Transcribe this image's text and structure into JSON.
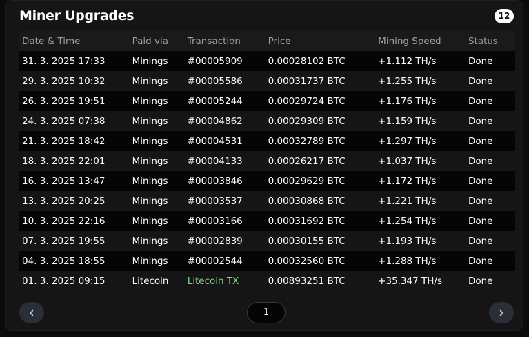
{
  "header": {
    "title": "Miner Upgrades",
    "count": "12"
  },
  "table": {
    "columns": [
      "Date & Time",
      "Paid via",
      "Transaction",
      "Price",
      "Mining Speed",
      "Status"
    ],
    "rows": [
      {
        "date": "31. 3. 2025 17:33",
        "paid": "Minings",
        "tx": "#00005909",
        "price": "0.00028102 BTC",
        "speed": "+1.112 TH/s",
        "status": "Done"
      },
      {
        "date": "29. 3. 2025 10:32",
        "paid": "Minings",
        "tx": "#00005586",
        "price": "0.00031737 BTC",
        "speed": "+1.255 TH/s",
        "status": "Done"
      },
      {
        "date": "26. 3. 2025 19:51",
        "paid": "Minings",
        "tx": "#00005244",
        "price": "0.00029724 BTC",
        "speed": "+1.176 TH/s",
        "status": "Done"
      },
      {
        "date": "24. 3. 2025 07:38",
        "paid": "Minings",
        "tx": "#00004862",
        "price": "0.00029309 BTC",
        "speed": "+1.159 TH/s",
        "status": "Done"
      },
      {
        "date": "21. 3. 2025 18:42",
        "paid": "Minings",
        "tx": "#00004531",
        "price": "0.00032789 BTC",
        "speed": "+1.297 TH/s",
        "status": "Done"
      },
      {
        "date": "18. 3. 2025 22:01",
        "paid": "Minings",
        "tx": "#00004133",
        "price": "0.00026217 BTC",
        "speed": "+1.037 TH/s",
        "status": "Done"
      },
      {
        "date": "16. 3. 2025 13:47",
        "paid": "Minings",
        "tx": "#00003846",
        "price": "0.00029629 BTC",
        "speed": "+1.172 TH/s",
        "status": "Done"
      },
      {
        "date": "13. 3. 2025 20:25",
        "paid": "Minings",
        "tx": "#00003537",
        "price": "0.00030868 BTC",
        "speed": "+1.221 TH/s",
        "status": "Done"
      },
      {
        "date": "10. 3. 2025 22:16",
        "paid": "Minings",
        "tx": "#00003166",
        "price": "0.00031692 BTC",
        "speed": "+1.254 TH/s",
        "status": "Done"
      },
      {
        "date": "07. 3. 2025 19:55",
        "paid": "Minings",
        "tx": "#00002839",
        "price": "0.00030155 BTC",
        "speed": "+1.193 TH/s",
        "status": "Done"
      },
      {
        "date": "04. 3. 2025 18:55",
        "paid": "Minings",
        "tx": "#00002544",
        "price": "0.00032560 BTC",
        "speed": "+1.288 TH/s",
        "status": "Done"
      },
      {
        "date": "01. 3. 2025 09:15",
        "paid": "Litecoin",
        "tx": "Litecoin TX",
        "price": "0.00893251 BTC",
        "speed": "+35.347 TH/s",
        "status": "Done"
      }
    ]
  },
  "pagination": {
    "current_page": "1",
    "prev_icon": "chevron-left-icon",
    "next_icon": "chevron-right-icon"
  },
  "colors": {
    "background": "#0b0b0b",
    "panel": "#151515",
    "link": "#7fd38a",
    "header_text": "#a0a0a0"
  }
}
